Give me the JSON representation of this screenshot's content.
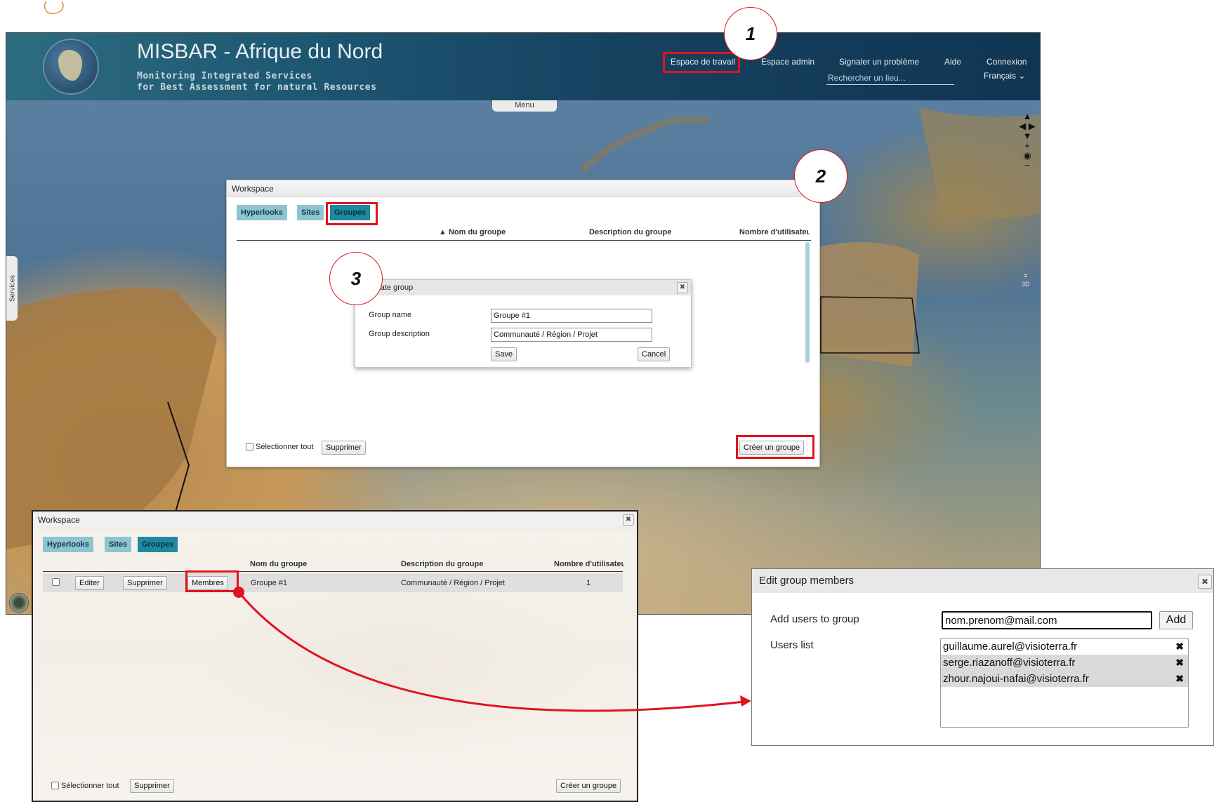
{
  "header": {
    "app_title": "MISBAR - Afrique du Nord",
    "subtitle_line1": "Monitoring Integrated Services",
    "subtitle_line2": "for Best Assessment for natural Resources",
    "nav": {
      "workspace": "Espace de travail",
      "admin": "Espace admin",
      "report": "Signaler un problème",
      "help": "Aide",
      "login": "Connexion"
    },
    "search_placeholder": "Rechercher un lieu...",
    "language": "Français ⌄"
  },
  "map_ui": {
    "menu_label": "Menu",
    "services_label": "Services",
    "nav_controls": [
      "▲",
      "◀ ▶",
      "▼",
      "+",
      "◉",
      "−"
    ],
    "layer_controls": [
      "≡",
      "3D"
    ]
  },
  "workspace_top": {
    "title": "Workspace",
    "tabs": [
      "Hyperlooks",
      "Sites",
      "Groupes"
    ],
    "columns": {
      "name": "▲ Nom du groupe",
      "description": "Description du groupe",
      "users": "Nombre d'utilisateu"
    },
    "select_all": "Sélectionner tout",
    "delete": "Supprimer",
    "create": "Créer un groupe"
  },
  "create_dialog": {
    "title": "Create group",
    "name_label": "Group name",
    "name_value": "Groupe #1",
    "desc_label": "Group description",
    "desc_value": "Communauté / Région / Projet",
    "save": "Save",
    "cancel": "Cancel",
    "close": "✖"
  },
  "markers": [
    "1",
    "2",
    "3"
  ],
  "workspace_bottom": {
    "title": "Workspace",
    "close": "✖",
    "tabs": [
      "Hyperlooks",
      "Sites",
      "Groupes"
    ],
    "columns": {
      "name": "Nom du groupe",
      "description": "Description du groupe",
      "users": "Nombre d'utilisateu"
    },
    "row": {
      "edit": "Editer",
      "delete": "Supprimer",
      "members": "Membres",
      "name": "Groupe #1",
      "description": "Communauté / Région / Projet",
      "users": "1"
    },
    "select_all": "Sélectionner tout",
    "delete": "Supprimer",
    "create": "Créer un groupe"
  },
  "edit_members": {
    "title": "Edit group members",
    "close": "✖",
    "add_label": "Add users to group",
    "input_value": "nom.prenom@mail.com",
    "add_button": "Add",
    "list_label": "Users list",
    "users": [
      "guillaume.aurel@visioterra.fr",
      "serge.riazanoff@visioterra.fr",
      "zhour.najoui-nafai@visioterra.fr"
    ],
    "remove_icon": "✖"
  },
  "colors": {
    "highlight": "#e0141e",
    "tab": "#8fc4d1",
    "tab_active": "#1e8aa1",
    "header": "#16415f"
  }
}
